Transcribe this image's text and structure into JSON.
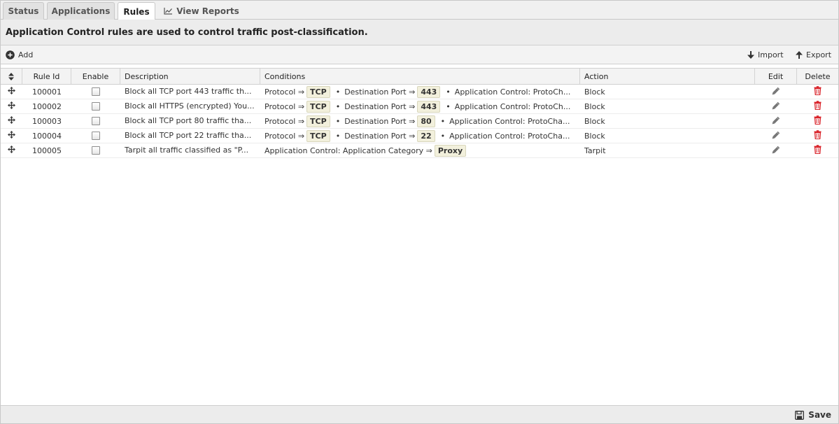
{
  "tabs": [
    {
      "label": "Status"
    },
    {
      "label": "Applications"
    },
    {
      "label": "Rules"
    },
    {
      "label": "View Reports"
    }
  ],
  "description": "Application Control rules are used to control traffic post-classification.",
  "toolbar": {
    "add": "Add",
    "import": "Import",
    "export": "Export"
  },
  "columns": {
    "reorder_icon": "sort-arrows-icon",
    "rule_id": "Rule Id",
    "enable": "Enable",
    "description": "Description",
    "conditions": "Conditions",
    "action": "Action",
    "edit": "Edit",
    "delete": "Delete"
  },
  "condition_labels": {
    "protocol": "Protocol ⇒",
    "dest_port": "Destination Port ⇒",
    "app_control": "Application Control: ProtoCh...",
    "app_control_alt": "Application Control: ProtoCha...",
    "app_category": "Application Control: Application Category ⇒"
  },
  "rules": [
    {
      "id": "100001",
      "enabled": false,
      "description": "Block all TCP port 443 traffic th...",
      "protocol": "TCP",
      "port": "443",
      "action": "Block"
    },
    {
      "id": "100002",
      "enabled": false,
      "description": "Block all HTTPS (encrypted) You...",
      "protocol": "TCP",
      "port": "443",
      "action": "Block"
    },
    {
      "id": "100003",
      "enabled": false,
      "description": "Block all TCP port 80 traffic tha...",
      "protocol": "TCP",
      "port": "80",
      "action": "Block"
    },
    {
      "id": "100004",
      "enabled": false,
      "description": "Block all TCP port 22 traffic tha...",
      "protocol": "TCP",
      "port": "22",
      "action": "Block"
    },
    {
      "id": "100005",
      "enabled": false,
      "description": "Tarpit all traffic classified as \"P...",
      "category": "Proxy",
      "action": "Tarpit"
    }
  ],
  "footer": {
    "save": "Save"
  },
  "colors": {
    "delete": "#d9232a",
    "chip_bg": "#f2f0dc",
    "header_bg": "#f3f3f3"
  }
}
